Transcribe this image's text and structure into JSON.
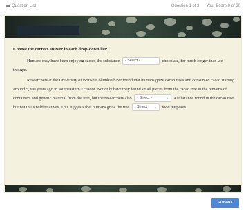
{
  "header": {
    "question_list_label": "Question List",
    "question_counter": "Question 1 of 2",
    "score": "Your Score 0 of 20"
  },
  "question": {
    "instruction": "Choose the correct answer in each drop-down list:",
    "p1_before": "Humans may have been enjoying cacao, the substance",
    "p1_after": "chocolate, for much longer than we thought.",
    "p2_before": "Researchers at the University of British Columbia have found that humans grew cacao trees and consumed cacao starting around 5,300 years ago in southeastern Ecuador. Not only have they found small pieces from the cacao tree in the remains of containers and genetic material from the tree, but the researchers also",
    "p2_middle": "a substance found in the cacao tree but not in its wild relatives. This suggests that humans grew the tree",
    "p2_after": "food purposes.",
    "dropdown_placeholder": "- Select -"
  },
  "actions": {
    "submit_label": "SUBMIT"
  },
  "colors": {
    "card_background": "#f4f1df",
    "submit_button": "#4c88d6"
  }
}
